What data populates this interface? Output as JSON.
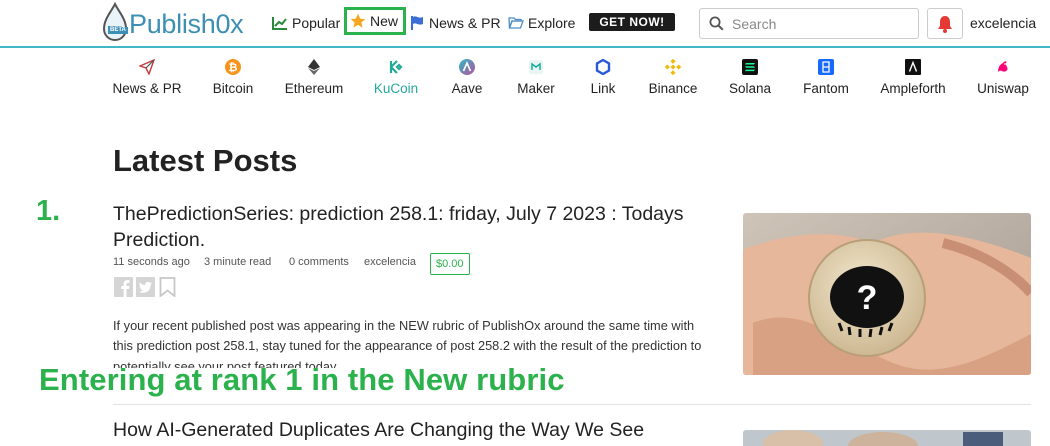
{
  "header": {
    "logo_text": "Publish0x",
    "logo_badge": "BETA",
    "nav": {
      "popular": "Popular",
      "new": "New",
      "news_pr": "News & PR",
      "explore": "Explore"
    },
    "cta": "GET NOW!",
    "search_placeholder": "Search",
    "username": "excelencia"
  },
  "categories": [
    {
      "label": "News & PR",
      "icon": "paper-plane-icon"
    },
    {
      "label": "Bitcoin",
      "icon": "bitcoin-icon"
    },
    {
      "label": "Ethereum",
      "icon": "ethereum-icon"
    },
    {
      "label": "KuCoin",
      "icon": "kucoin-icon"
    },
    {
      "label": "Aave",
      "icon": "aave-icon"
    },
    {
      "label": "Maker",
      "icon": "maker-icon"
    },
    {
      "label": "Link",
      "icon": "chainlink-icon"
    },
    {
      "label": "Binance",
      "icon": "binance-icon"
    },
    {
      "label": "Solana",
      "icon": "solana-icon"
    },
    {
      "label": "Fantom",
      "icon": "fantom-icon"
    },
    {
      "label": "Ampleforth",
      "icon": "ampleforth-icon"
    },
    {
      "label": "Uniswap",
      "icon": "uniswap-icon"
    }
  ],
  "main": {
    "title": "Latest Posts",
    "rank_annotation": "1.",
    "overlay_annotation": "Entering at rank 1 in the New rubric",
    "posts": [
      {
        "title": "ThePredictionSeries: prediction 258.1: friday, July 7 2023 : Todays Prediction.",
        "time_ago": "11 seconds ago",
        "read_time": "3 minute read",
        "comments": "0 comments",
        "author": "excelencia",
        "earnings": "$0.00",
        "excerpt": "If your recent published post was appearing in the NEW rubric of PublishOx around the same time with this prediction post 258.1, stay tuned for the appearance of post 258.2 with the result of the prediction to potentially see your post featured today..."
      },
      {
        "title": "How AI-Generated Duplicates Are Changing the Way We See"
      }
    ]
  },
  "colors": {
    "accent": "#41b6c4",
    "annotation_green": "#2bb24c",
    "kucoin": "#25a99a",
    "bell": "#e53935"
  }
}
